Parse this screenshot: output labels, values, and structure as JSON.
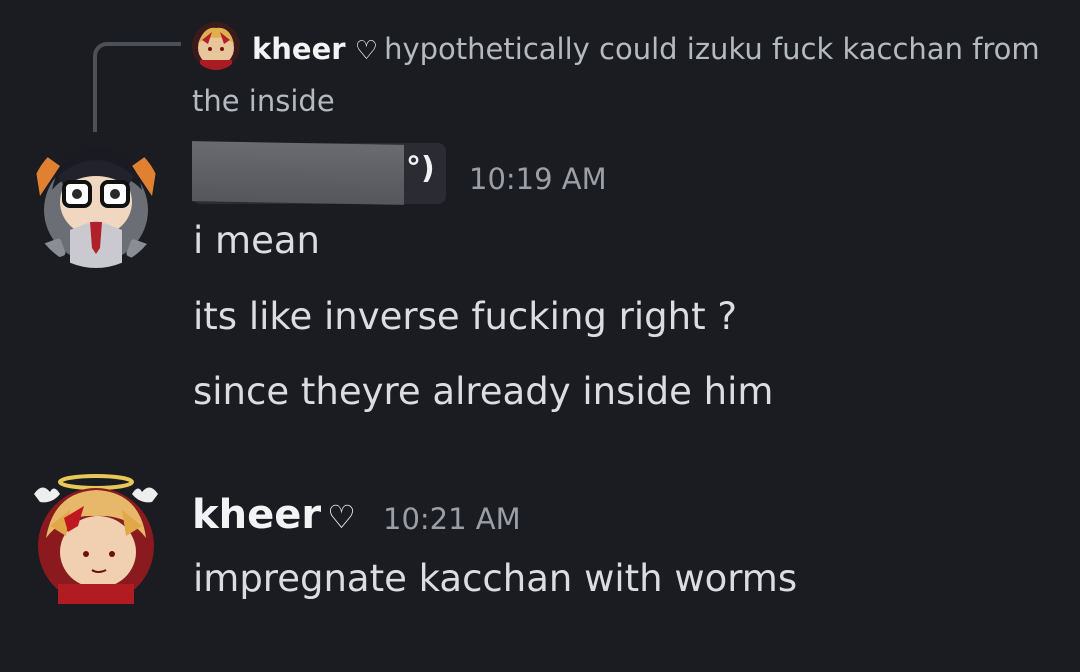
{
  "reply": {
    "author": "kheer",
    "heart": "♡",
    "text": "hypothetically could izuku fuck kacchan from the inside"
  },
  "messages": [
    {
      "author_visible_suffix": "°)",
      "timestamp": "10:19 AM",
      "lines": [
        "i mean",
        "its like inverse fucking right ?",
        "since theyre already inside him"
      ]
    },
    {
      "author": "kheer",
      "heart": "♡",
      "timestamp": "10:21 AM",
      "lines": [
        "impregnate kacchan with worms"
      ]
    }
  ],
  "colors": {
    "background": "#1b1c21",
    "text": "#dbdee1",
    "muted": "#9a9ea6",
    "username": "#f2f3f5"
  }
}
